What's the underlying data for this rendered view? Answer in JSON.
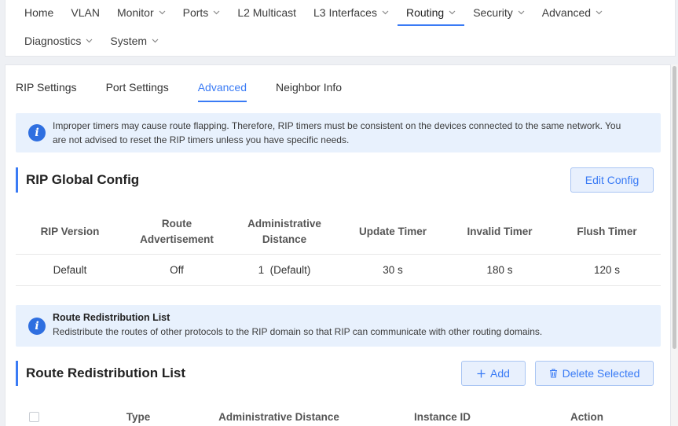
{
  "nav": {
    "row1": [
      {
        "label": "Home",
        "dropdown": false,
        "active": false
      },
      {
        "label": "VLAN",
        "dropdown": false,
        "active": false
      },
      {
        "label": "Monitor",
        "dropdown": true,
        "active": false
      },
      {
        "label": "Ports",
        "dropdown": true,
        "active": false
      },
      {
        "label": "L2 Multicast",
        "dropdown": false,
        "active": false
      },
      {
        "label": "L3 Interfaces",
        "dropdown": true,
        "active": false
      },
      {
        "label": "Routing",
        "dropdown": true,
        "active": true
      },
      {
        "label": "Security",
        "dropdown": true,
        "active": false
      },
      {
        "label": "Advanced",
        "dropdown": true,
        "active": false
      }
    ],
    "row2": [
      {
        "label": "Diagnostics",
        "dropdown": true,
        "active": false
      },
      {
        "label": "System",
        "dropdown": true,
        "active": false
      }
    ]
  },
  "tabs": [
    {
      "label": "RIP Settings",
      "active": false
    },
    {
      "label": "Port Settings",
      "active": false
    },
    {
      "label": "Advanced",
      "active": true
    },
    {
      "label": "Neighbor Info",
      "active": false
    }
  ],
  "notice1": {
    "text": "Improper timers may cause route flapping. Therefore, RIP timers must be consistent on the devices connected to the same network. You are not advised to reset the RIP timers unless you have specific needs."
  },
  "global_config": {
    "title": "RIP Global Config",
    "edit_label": "Edit Config",
    "headers": {
      "version": "RIP Version",
      "route_adv": "Route Advertisement",
      "admin_distance": "Administrative Distance",
      "update_timer": "Update Timer",
      "invalid_timer": "Invalid Timer",
      "flush_timer": "Flush Timer"
    },
    "row": {
      "version": "Default",
      "route_adv": "Off",
      "admin_distance": "1  (Default)",
      "update_timer": "30 s",
      "invalid_timer": "180 s",
      "flush_timer": "120 s"
    }
  },
  "notice2": {
    "title": "Route Redistribution List",
    "text": "Redistribute the routes of other protocols to the RIP domain so that RIP can communicate with other routing domains."
  },
  "redistribution": {
    "title": "Route Redistribution List",
    "add_label": "Add",
    "delete_label": "Delete Selected",
    "headers": {
      "type": "Type",
      "admin_distance": "Administrative Distance",
      "instance_id": "Instance ID",
      "action": "Action"
    }
  },
  "colors": {
    "accent": "#3a7bf5",
    "notice_bg": "#e8f1fd",
    "info_icon": "#2f6fe0"
  }
}
